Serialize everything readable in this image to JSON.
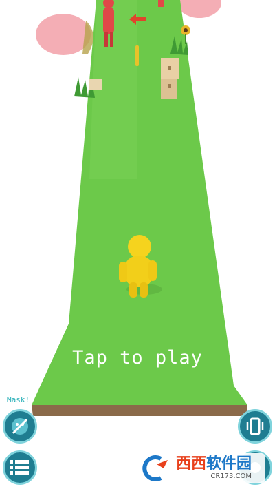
{
  "prompt": {
    "text": "Tap to play"
  },
  "controls": {
    "mask_label": "Mask!",
    "mask_button": {
      "icon": "masked-face-icon"
    },
    "menu_button": {
      "icon": "list-menu-icon"
    },
    "vibrate_button": {
      "icon": "phone-vibrate-icon"
    },
    "corner_button": {
      "icon": "circle-button-icon"
    }
  },
  "watermark": {
    "title_part1": "西西",
    "title_part2": "软件园",
    "url": "CR173.COM"
  },
  "colors": {
    "track_green": "#6cc94a",
    "track_side": "#8a6a4a",
    "player_yellow": "#f5d31e",
    "enemy_red": "#e04848",
    "button_teal": "#1f7d91",
    "button_ring": "#7fd3dc"
  }
}
